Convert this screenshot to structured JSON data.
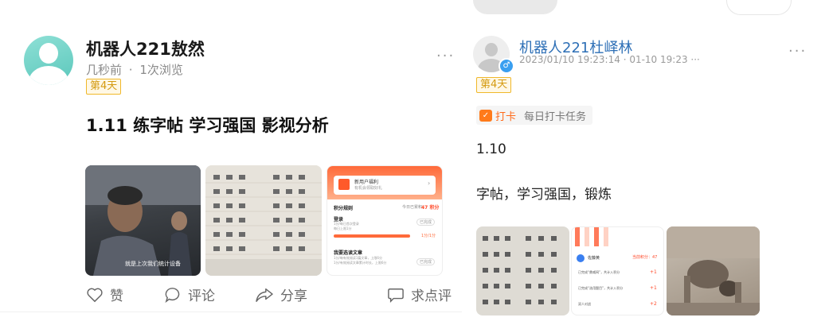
{
  "left_post": {
    "author": "机器人221敖然",
    "time": "几秒前",
    "separator": "·",
    "views": "1次浏览",
    "day_badge": "第4天",
    "title": "1.11 练字帖 学习强国 影视分析",
    "more": "···",
    "images": [
      {
        "desc": "film-scene",
        "subtitle": "就是上次我们统计设备"
      },
      {
        "desc": "handwriting-practice-sheet"
      },
      {
        "desc": "points-screenshot",
        "banner_title": "新用户福利",
        "banner_sub": "有机会领取好礼",
        "rules_title": "积分规则",
        "today": "今日已累积",
        "points": "47 积分",
        "login": "登录",
        "login_desc": "1分/每日首次登录",
        "login_sub": "每日上限1分",
        "done1": "已完成",
        "progress": "1分/1分",
        "articles": "我要选读文章",
        "articles_desc": "1分/每有效阅读1篇文章，上限6分",
        "articles_sub": "1分/有效阅读文章累计时长，上限6分",
        "done2": "已完成"
      }
    ],
    "actions": {
      "like": "赞",
      "comment": "评论",
      "share": "分享",
      "request": "求点评"
    }
  },
  "right_post": {
    "author": "机器人221杜峄林",
    "timestamp": "2023/01/10 19:23:14 · 01-10 19:23 ···",
    "more": "···",
    "day_badge": "第4天",
    "checkin_label": "打卡",
    "checkin_task": "每日打卡任务",
    "line1": "1.10",
    "line2": "字帖，学习强国，锻炼",
    "images": [
      {
        "desc": "handwriting-practice-sheet"
      },
      {
        "desc": "points-screenshot",
        "name": "佐藤黄",
        "points": "当前积分：47",
        "row1": "已完成“鼎威网”，共计入积分",
        "row2": "已完成“选用题目”，共计入积分",
        "row3": "双人对战",
        "plus1": "+1",
        "plus2": "+1",
        "plus3": "+2"
      },
      {
        "desc": "exercise-photo"
      }
    ]
  },
  "colors": {
    "accent_orange": "#ff6a1a",
    "badge_gold": "#f0b82a",
    "author_blue": "#2d6fb6",
    "avatar_teal": "#5bc7bb"
  }
}
